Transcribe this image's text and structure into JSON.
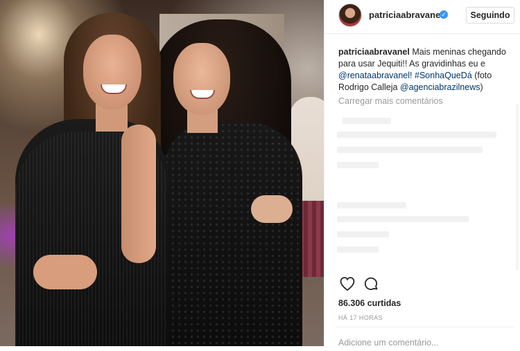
{
  "post": {
    "username": "patriciaabravanel",
    "follow_label": "Seguindo",
    "caption": {
      "username": "patriciaabravanel",
      "text_1": "Mais meninas chegando para usar Jequiti!! As gravidinhas eu e",
      "mention_1": "@renataabravanel!",
      "hashtag": "#SonhaQueDá",
      "text_2": "(foto Rodrigo Calleja",
      "mention_2": "@agenciabrazilnews",
      "text_3": ")"
    },
    "load_more_comments": "Carregar mais comentários",
    "likes": "86.306 curtidas",
    "time": "HÁ 17 HORAS",
    "comment_placeholder": "Adicione um comentário..."
  },
  "icons": {
    "verified": "verified-badge-icon",
    "like": "heart-icon",
    "comment": "comment-bubble-icon"
  },
  "colors": {
    "verified": "#3897f0",
    "link": "#003569",
    "muted": "#999999"
  }
}
